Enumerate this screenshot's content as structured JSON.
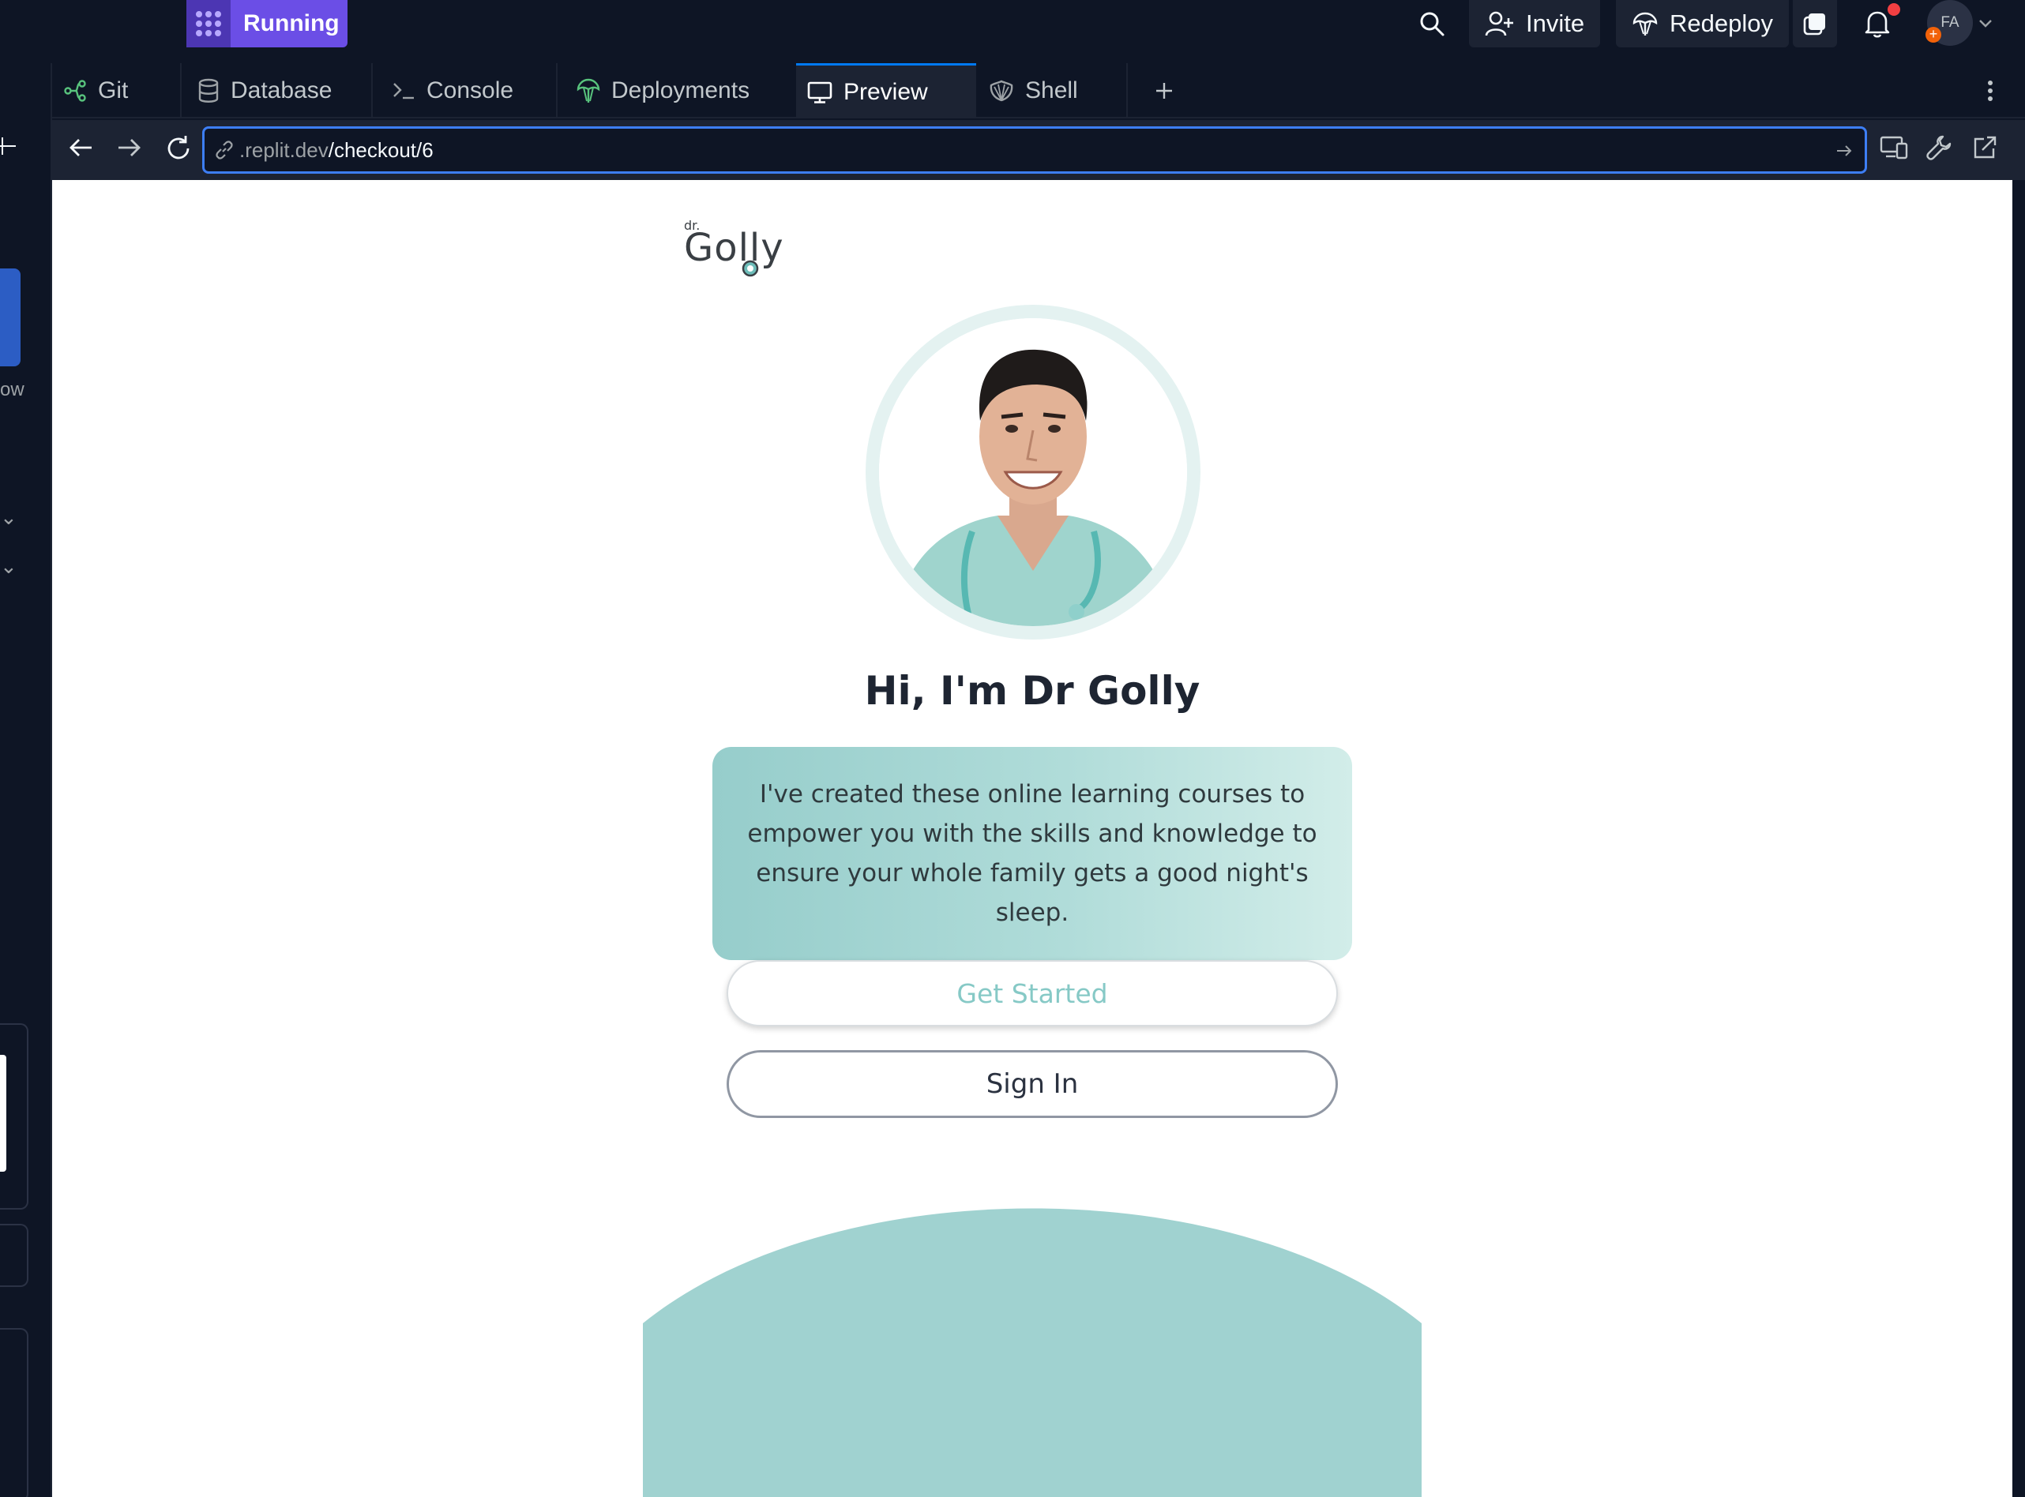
{
  "topbar": {
    "run_label": "Running",
    "invite_label": "Invite",
    "redeploy_label": "Redeploy",
    "avatar_initials": "FA"
  },
  "left_strip": {
    "partial_text": "ow"
  },
  "tabs": [
    {
      "label": "Git",
      "icon": "git-icon"
    },
    {
      "label": "Database",
      "icon": "database-icon"
    },
    {
      "label": "Console",
      "icon": "console-icon"
    },
    {
      "label": "Deployments",
      "icon": "deployments-icon"
    },
    {
      "label": "Preview",
      "icon": "monitor-icon",
      "active": true
    },
    {
      "label": "Shell",
      "icon": "shell-icon"
    }
  ],
  "address": {
    "host": ".replit.dev",
    "path": "/checkout/6"
  },
  "page": {
    "logo_small": "dr.",
    "logo_main": "Golly",
    "title": "Hi, I'm Dr Golly",
    "intro": "I've created these online learning courses to empower you with the skills and knowledge to ensure your whole family gets a good night's sleep.",
    "get_started": "Get Started",
    "sign_in": "Sign In"
  },
  "colors": {
    "accent": "#6b4ee6",
    "url_focus": "#3d7ef5",
    "teal": "#a0d2d0",
    "notification": "#f23f42"
  }
}
